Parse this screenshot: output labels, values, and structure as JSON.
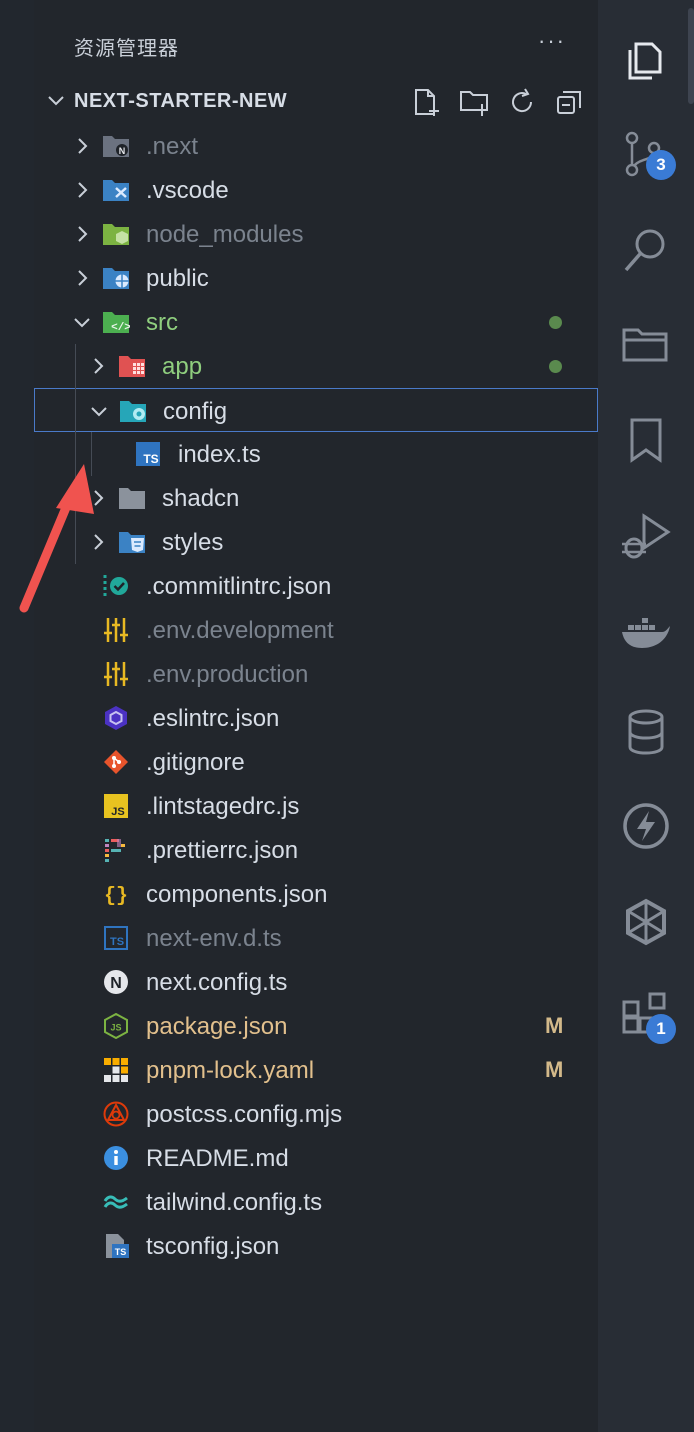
{
  "explorer": {
    "title": "资源管理器",
    "more": "···"
  },
  "project": {
    "name": "NEXT-STARTER-NEW",
    "actions": [
      "new-file-icon",
      "new-folder-icon",
      "refresh-icon",
      "collapse-all-icon"
    ]
  },
  "tree": [
    {
      "label": ".next",
      "type": "folder",
      "expanded": false,
      "depth": 0,
      "icon": "next-folder-icon",
      "dim": true
    },
    {
      "label": ".vscode",
      "type": "folder",
      "expanded": false,
      "depth": 0,
      "icon": "vscode-folder-icon"
    },
    {
      "label": "node_modules",
      "type": "folder",
      "expanded": false,
      "depth": 0,
      "icon": "node-folder-icon",
      "dim": true
    },
    {
      "label": "public",
      "type": "folder",
      "expanded": false,
      "depth": 0,
      "icon": "public-folder-icon"
    },
    {
      "label": "src",
      "type": "folder",
      "expanded": true,
      "depth": 0,
      "icon": "src-folder-icon",
      "color": "green",
      "dot": true
    },
    {
      "label": "app",
      "type": "folder",
      "expanded": false,
      "depth": 1,
      "icon": "app-folder-icon",
      "color": "green",
      "dot": true
    },
    {
      "label": "config",
      "type": "folder",
      "expanded": true,
      "depth": 1,
      "icon": "config-folder-icon",
      "selected": true
    },
    {
      "label": "index.ts",
      "type": "file",
      "depth": 2,
      "icon": "typescript-icon"
    },
    {
      "label": "shadcn",
      "type": "folder",
      "expanded": false,
      "depth": 1,
      "icon": "folder-icon"
    },
    {
      "label": "styles",
      "type": "folder",
      "expanded": false,
      "depth": 1,
      "icon": "styles-folder-icon"
    },
    {
      "label": ".commitlintrc.json",
      "type": "file",
      "depth": 0,
      "icon": "commitlint-icon"
    },
    {
      "label": ".env.development",
      "type": "file",
      "depth": 0,
      "icon": "env-icon",
      "dim": true
    },
    {
      "label": ".env.production",
      "type": "file",
      "depth": 0,
      "icon": "env-icon",
      "dim": true
    },
    {
      "label": ".eslintrc.json",
      "type": "file",
      "depth": 0,
      "icon": "eslint-icon"
    },
    {
      "label": ".gitignore",
      "type": "file",
      "depth": 0,
      "icon": "git-icon"
    },
    {
      "label": ".lintstagedrc.js",
      "type": "file",
      "depth": 0,
      "icon": "javascript-icon"
    },
    {
      "label": ".prettierrc.json",
      "type": "file",
      "depth": 0,
      "icon": "prettier-icon"
    },
    {
      "label": "components.json",
      "type": "file",
      "depth": 0,
      "icon": "json-icon"
    },
    {
      "label": "next-env.d.ts",
      "type": "file",
      "depth": 0,
      "icon": "typescript-def-icon",
      "dim": true
    },
    {
      "label": "next.config.ts",
      "type": "file",
      "depth": 0,
      "icon": "next-icon"
    },
    {
      "label": "package.json",
      "type": "file",
      "depth": 0,
      "icon": "nodejs-icon",
      "color": "yellow",
      "badge": "M"
    },
    {
      "label": "pnpm-lock.yaml",
      "type": "file",
      "depth": 0,
      "icon": "pnpm-icon",
      "color": "yellow",
      "badge": "M"
    },
    {
      "label": "postcss.config.mjs",
      "type": "file",
      "depth": 0,
      "icon": "postcss-icon"
    },
    {
      "label": "README.md",
      "type": "file",
      "depth": 0,
      "icon": "info-icon"
    },
    {
      "label": "tailwind.config.ts",
      "type": "file",
      "depth": 0,
      "icon": "tailwind-icon"
    },
    {
      "label": "tsconfig.json",
      "type": "file",
      "depth": 0,
      "icon": "tsconfig-icon"
    }
  ],
  "activity": [
    {
      "name": "explorer-icon",
      "active": true
    },
    {
      "name": "source-control-icon",
      "badge": "3"
    },
    {
      "name": "search-icon"
    },
    {
      "name": "remote-explorer-icon"
    },
    {
      "name": "bookmark-icon"
    },
    {
      "name": "run-debug-icon"
    },
    {
      "name": "docker-icon"
    },
    {
      "name": "database-icon"
    },
    {
      "name": "thunder-client-icon"
    },
    {
      "name": "openai-icon"
    },
    {
      "name": "extensions-icon",
      "badge": "1"
    }
  ],
  "colors": {
    "accent": "#3a7bd5",
    "selection_border": "#4a7ac9",
    "annotation_arrow": "#f0534f"
  }
}
